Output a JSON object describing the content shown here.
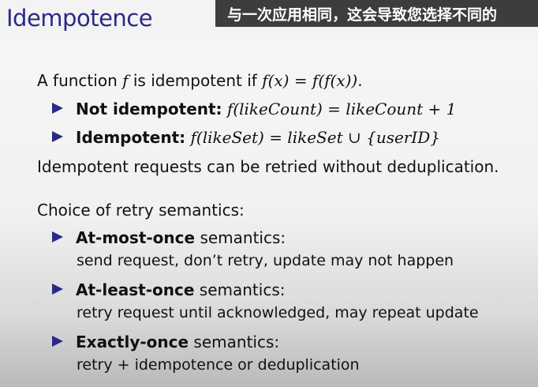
{
  "slide": {
    "title": "Idempotence",
    "subtitle_overlay": "与一次应用相同，这会导致您选择不同的"
  },
  "definition": {
    "text_before": "A function",
    "var": "f",
    "text_mid": "is idempotent if",
    "formula": "f(x) = f(f(x))",
    "period": "."
  },
  "examples": [
    {
      "label": "Not idempotent:",
      "formula": "f(likeCount) = likeCount + 1"
    },
    {
      "label": "Idempotent:",
      "formula": "f(likeSet) = likeSet ∪ {userID}"
    }
  ],
  "retry_note": "Idempotent requests can be retried without deduplication.",
  "semantics": {
    "heading": "Choice of retry semantics:",
    "items": [
      {
        "name": "At-most-once",
        "suffix": " semantics:",
        "desc": "send request, don’t retry, update may not happen"
      },
      {
        "name": "At-least-once",
        "suffix": " semantics:",
        "desc": "retry request until acknowledged, may repeat update"
      },
      {
        "name": "Exactly-once",
        "suffix": " semantics:",
        "desc": "retry + idempotence or deduplication"
      }
    ]
  },
  "colors": {
    "title": "#2a2a86",
    "bullet": "#2a2a86",
    "subtitle_bg": "#3d3d3d"
  }
}
